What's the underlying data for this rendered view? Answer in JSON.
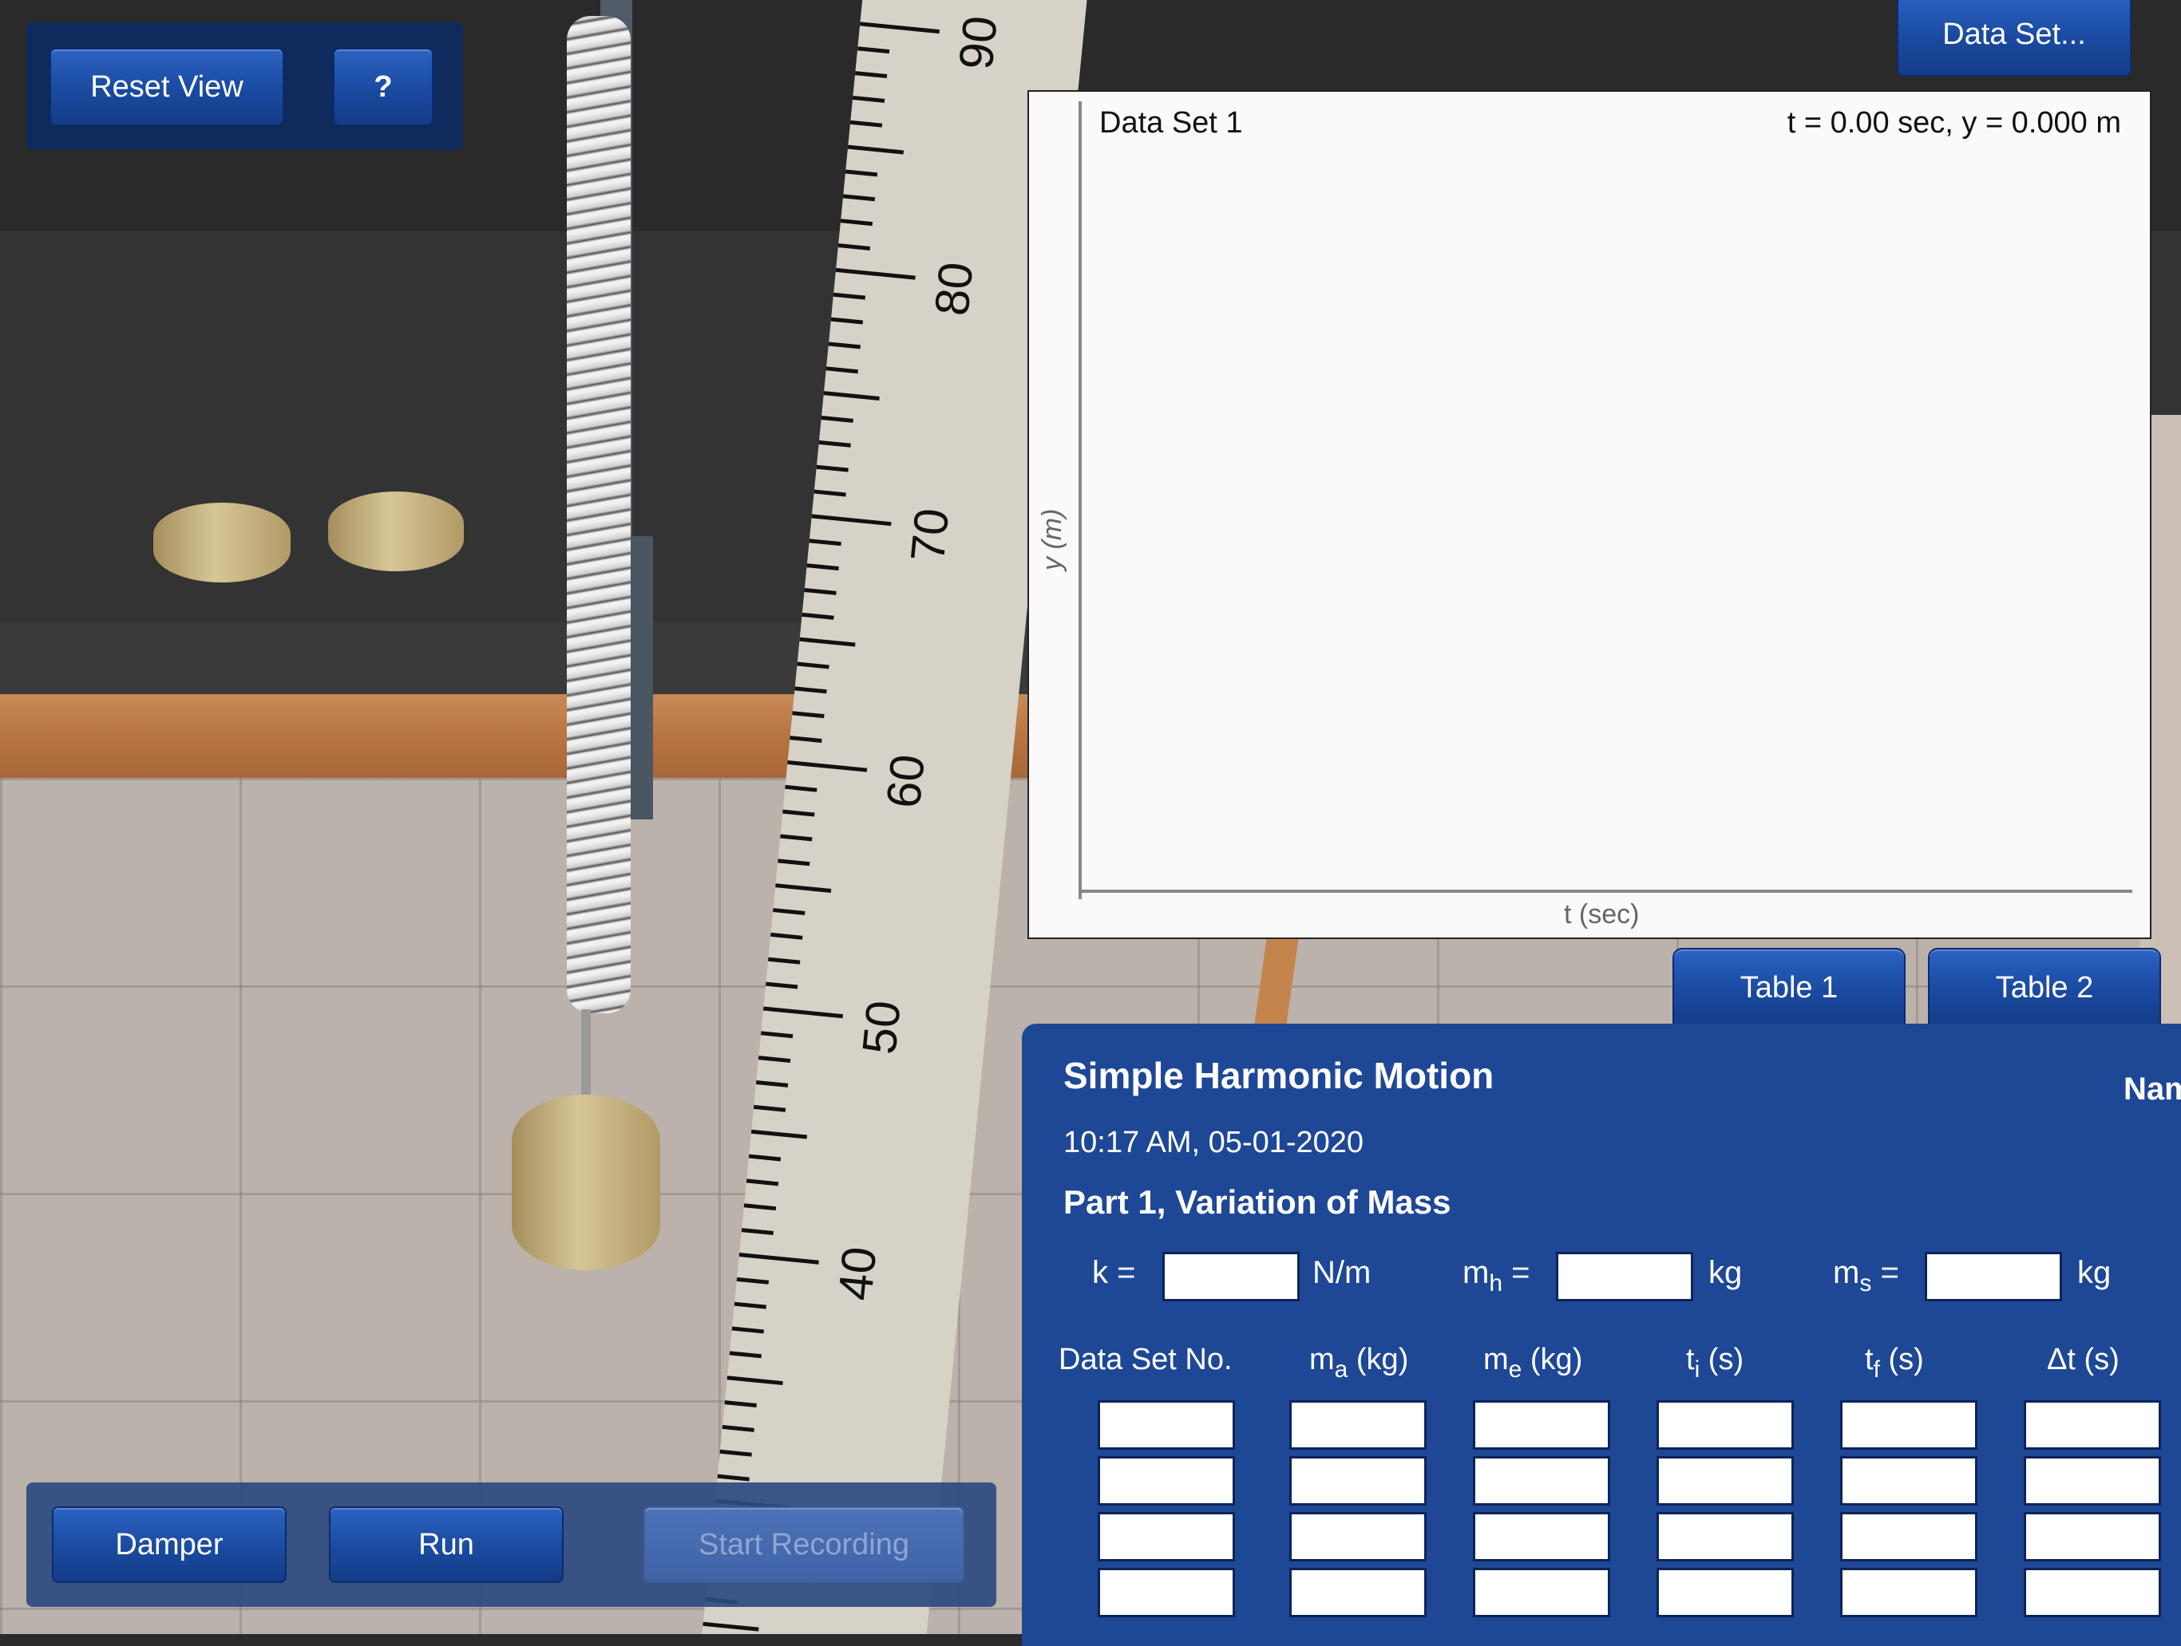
{
  "top_controls": {
    "reset_view_label": "Reset View",
    "help_label": "?"
  },
  "data_set_button": "Data Set...",
  "graph": {
    "title": "Data Set 1",
    "readout": "t = 0.00 sec,  y = 0.000 m",
    "y_label": "y (m)",
    "x_label": "t (sec)"
  },
  "ruler_labels": [
    "90",
    "80",
    "70",
    "60",
    "50",
    "40"
  ],
  "table_tabs": [
    "Table 1",
    "Table 2"
  ],
  "worksheet": {
    "title": "Simple Harmonic Motion",
    "name_label": "Nam",
    "datetime": "10:17 AM, 05-01-2020",
    "part": "Part 1, Variation of Mass",
    "k_label": "k =",
    "k_unit": "N/m",
    "mh_label": "m",
    "mh_sub": "h",
    "mh_eq": " =",
    "mh_unit": "kg",
    "ms_label": "m",
    "ms_sub": "s",
    "ms_eq": " =",
    "ms_unit": "kg",
    "columns": [
      {
        "main": "Data Set No.",
        "sub": "",
        "tail": ""
      },
      {
        "main": "m",
        "sub": "a",
        "tail": " (kg)"
      },
      {
        "main": "m",
        "sub": "e",
        "tail": " (kg)"
      },
      {
        "main": "t",
        "sub": "i",
        "tail": " (s)"
      },
      {
        "main": "t",
        "sub": "f",
        "tail": " (s)"
      },
      {
        "main": "Δt (s)",
        "sub": "",
        "tail": ""
      }
    ]
  },
  "bottom_controls": {
    "damper_label": "Damper",
    "run_label": "Run",
    "start_recording_label": "Start Recording"
  }
}
